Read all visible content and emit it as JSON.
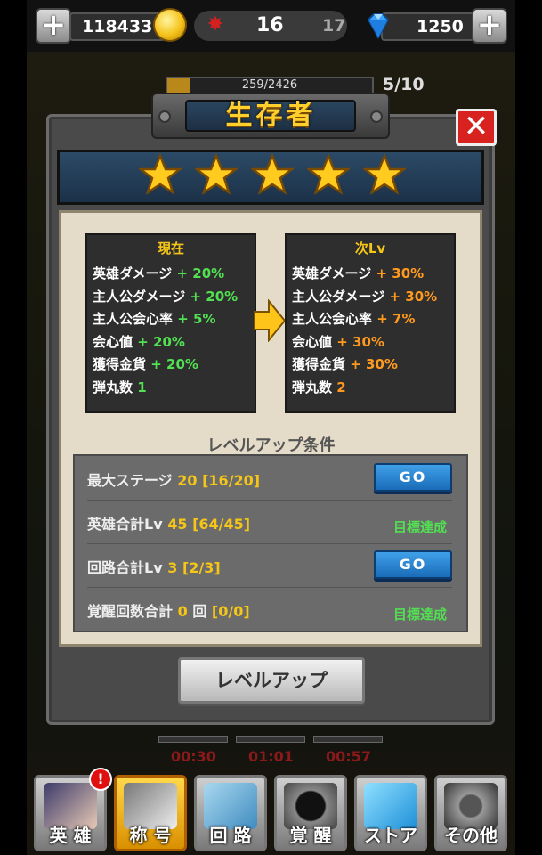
{
  "top": {
    "coins": "118433",
    "level": "16",
    "level_next": "17",
    "gems": "1250",
    "xp": "259/2426",
    "xp_fraction": 0.107,
    "stage_progress": "5/10"
  },
  "dialog": {
    "title": "生存者",
    "stars": 5,
    "current": {
      "header": "現在",
      "lines": [
        {
          "label": "英雄ダメージ",
          "value": "+ 20%"
        },
        {
          "label": "主人公ダメージ",
          "value": "+ 20%"
        },
        {
          "label": "主人公会心率",
          "value": "+ 5%"
        },
        {
          "label": "会心値",
          "value": "+ 20%"
        },
        {
          "label": "獲得金貨",
          "value": "+ 20%"
        },
        {
          "label": "弾丸数",
          "value": "1"
        }
      ]
    },
    "next": {
      "header": "次Lv",
      "lines": [
        {
          "label": "英雄ダメージ",
          "value": "+ 30%"
        },
        {
          "label": "主人公ダメージ",
          "value": "+ 30%"
        },
        {
          "label": "主人公会心率",
          "value": "+ 7%"
        },
        {
          "label": "会心値",
          "value": "+ 30%"
        },
        {
          "label": "獲得金貨",
          "value": "+ 30%"
        },
        {
          "label": "弾丸数",
          "value": "2"
        }
      ]
    },
    "conditions_title": "レベルアップ条件",
    "conditions": [
      {
        "label": "最大ステージ",
        "target": "20",
        "progress": "[16/20]",
        "action": "GO"
      },
      {
        "label": "英雄合計Lv",
        "target": "45",
        "progress": "[64/45]",
        "status": "目標達成"
      },
      {
        "label": "回路合計Lv",
        "target": "3",
        "progress": "[2/3]",
        "action": "GO"
      },
      {
        "label": "覚醒回数合計",
        "target": "0",
        "unit": "回",
        "progress": "[0/0]",
        "status": "目標達成"
      }
    ],
    "levelup_label": "レベルアップ"
  },
  "timers": [
    "00:30",
    "01:01",
    "00:57"
  ],
  "nav": [
    {
      "label": "英 雄",
      "badge": "!"
    },
    {
      "label": "称 号",
      "active": true
    },
    {
      "label": "回 路"
    },
    {
      "label": "覚 醒"
    },
    {
      "label": "ストア"
    },
    {
      "label": "その他"
    }
  ]
}
